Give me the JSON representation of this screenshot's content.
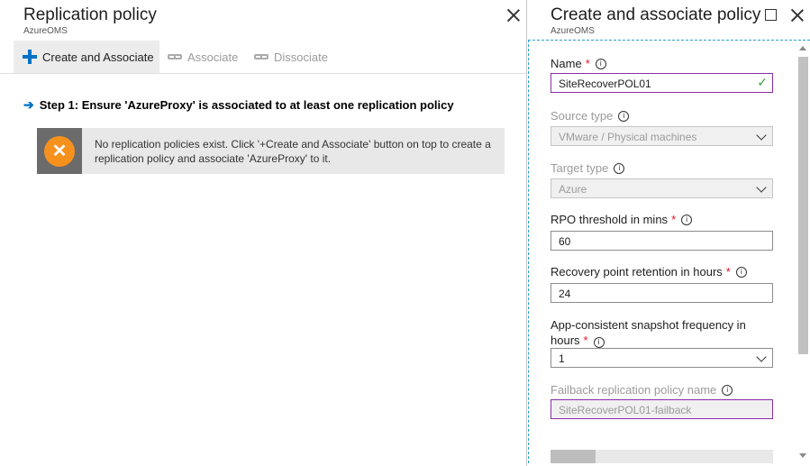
{
  "left_blade": {
    "title": "Replication policy",
    "subtitle": "AzureOMS",
    "toolbar": {
      "create_label": "Create and Associate",
      "associate_label": "Associate",
      "dissociate_label": "Dissociate"
    },
    "step_text": "Step 1: Ensure 'AzureProxy' is associated to at least one replication policy",
    "info_message": "No replication policies exist. Click '+Create and Associate' button on top to create a replication policy and associate 'AzureProxy' to it."
  },
  "right_blade": {
    "title": "Create and associate policy",
    "subtitle": "AzureOMS",
    "fields": {
      "name": {
        "label": "Name",
        "value": "SiteRecoverPOL01"
      },
      "source_type": {
        "label": "Source type",
        "value": "VMware / Physical machines"
      },
      "target_type": {
        "label": "Target type",
        "value": "Azure"
      },
      "rpo": {
        "label": "RPO threshold in mins",
        "value": "60"
      },
      "retention": {
        "label": "Recovery point retention in hours",
        "value": "24"
      },
      "snapshot": {
        "label": "App-consistent snapshot frequency in hours",
        "value": "1"
      },
      "failback": {
        "label": "Failback replication policy name",
        "value": "SiteRecoverPOL01-failback"
      }
    }
  },
  "icons": {
    "info": "i",
    "check": "✓",
    "arrow": "➔",
    "tools": "✕"
  },
  "colors": {
    "accent": "#0072c6",
    "required": "#e81123",
    "valid_border": "#8a2da5",
    "valid_check": "#3ba53b",
    "tools_icon": "#f7911e"
  }
}
